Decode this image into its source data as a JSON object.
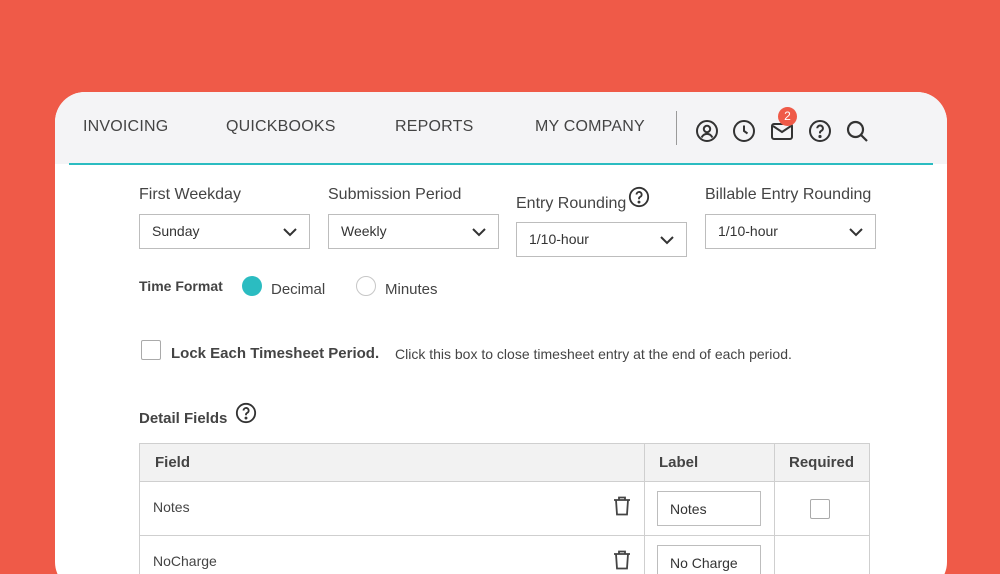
{
  "nav": {
    "items": [
      "INVOICING",
      "QUICKBOOKS",
      "REPORTS",
      "MY COMPANY"
    ],
    "icons": [
      "user-icon",
      "clock-icon",
      "mail-icon",
      "help-icon",
      "search-icon"
    ],
    "mail_badge": "2",
    "accent": "#2bbcc1",
    "badge_color": "#ef5a48"
  },
  "settings": {
    "first_weekday": {
      "label": "First Weekday",
      "value": "Sunday"
    },
    "submission_period": {
      "label": "Submission Period",
      "value": "Weekly"
    },
    "entry_rounding": {
      "label": "Entry Rounding",
      "value": "1/10-hour"
    },
    "billable_rounding": {
      "label": "Billable Entry Rounding",
      "value": "1/10-hour"
    },
    "time_format": {
      "label": "Time Format",
      "options": [
        "Decimal",
        "Minutes"
      ],
      "selected": "Decimal"
    },
    "lock": {
      "title": "Lock Each Timesheet Period.",
      "description": "Click this box to close timesheet entry at the end of each period.",
      "checked": false
    }
  },
  "detail_fields": {
    "title": "Detail Fields",
    "columns": [
      "Field",
      "Label",
      "Required"
    ],
    "rows": [
      {
        "field": "Notes",
        "label": "Notes",
        "required": false
      },
      {
        "field": "NoCharge",
        "label": "No Charge"
      }
    ]
  }
}
